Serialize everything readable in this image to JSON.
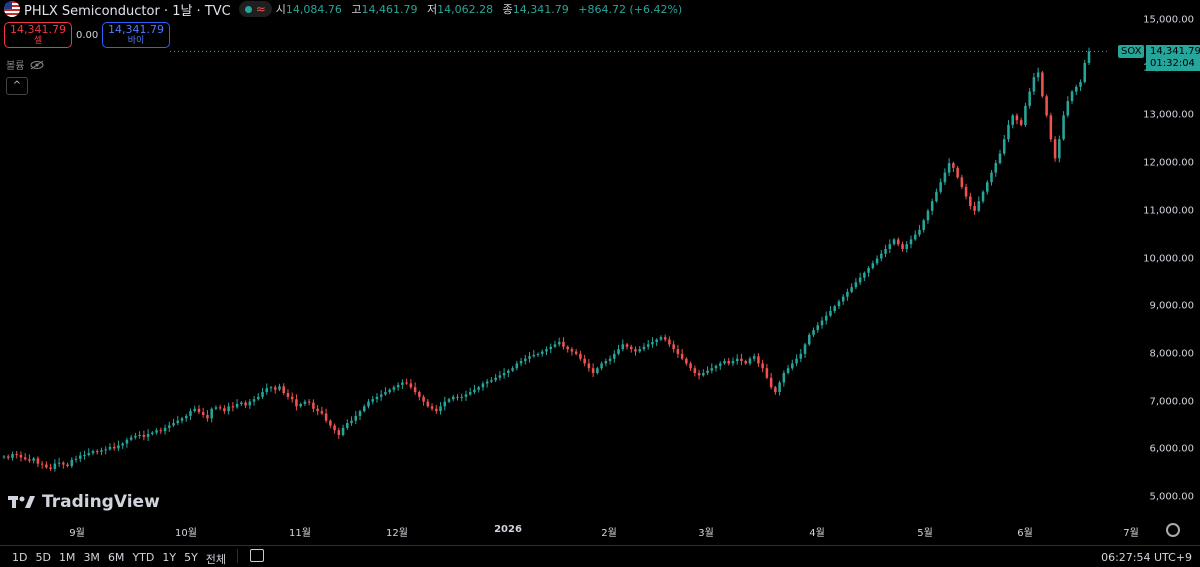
{
  "header": {
    "title": "PHLX Semiconductor · 1날 · TVC",
    "market_status_symbol": "≈",
    "ohlc": {
      "open_label": "시",
      "open": "14,084.76",
      "high_label": "고",
      "high": "14,461.79",
      "low_label": "저",
      "low": "14,062.28",
      "close_label": "종",
      "close": "14,341.79",
      "change": "+864.72 (+6.42%)"
    }
  },
  "trade": {
    "sell_price": "14,341.79",
    "sell_label": "셀",
    "spread": "0.00",
    "buy_price": "14,341.79",
    "buy_label": "바이"
  },
  "volume_label": "볼륨",
  "collapse_symbol": "^",
  "price_scale": {
    "ticks": [
      "15,000.00",
      "14,000.00",
      "13,000.00",
      "12,000.00",
      "11,000.00",
      "10,000.00",
      "9,000.00",
      "8,000.00",
      "7,000.00",
      "6,000.00",
      "5,000.00"
    ],
    "symbol_badge": "SOX",
    "last_price": "14,341.79",
    "countdown": "01:32:04"
  },
  "time_axis": {
    "ticks": [
      "9월",
      "10월",
      "11월",
      "12월",
      "2026",
      "2월",
      "3월",
      "4월",
      "5월",
      "6월",
      "7월"
    ]
  },
  "logo_text": "TradingView",
  "ranges": [
    "1D",
    "5D",
    "1M",
    "3M",
    "6M",
    "YTD",
    "1Y",
    "5Y",
    "전체"
  ],
  "clock": "06:27:54 UTC+9",
  "colors": {
    "up": "#26a69a",
    "down": "#ef5350",
    "background": "#000000"
  },
  "chart_data": {
    "type": "candlestick",
    "symbol": "SOX",
    "interval": "1D",
    "ylim": [
      5000,
      15000
    ],
    "close_series": [
      5850,
      5820,
      5900,
      5880,
      5830,
      5790,
      5760,
      5810,
      5700,
      5680,
      5620,
      5590,
      5700,
      5720,
      5680,
      5650,
      5780,
      5800,
      5870,
      5880,
      5920,
      5960,
      5950,
      5980,
      6000,
      6050,
      6020,
      6080,
      6120,
      6200,
      6250,
      6280,
      6300,
      6260,
      6320,
      6350,
      6400,
      6380,
      6450,
      6500,
      6550,
      6600,
      6650,
      6700,
      6800,
      6850,
      6780,
      6720,
      6650,
      6850,
      6880,
      6860,
      6800,
      6900,
      6880,
      6950,
      6980,
      6920,
      7000,
      7050,
      7100,
      7200,
      7280,
      7300,
      7250,
      7320,
      7180,
      7100,
      7050,
      6900,
      6950,
      7000,
      6980,
      6850,
      6800,
      6750,
      6600,
      6500,
      6400,
      6300,
      6450,
      6550,
      6600,
      6700,
      6800,
      6900,
      7000,
      7050,
      7100,
      7150,
      7200,
      7250,
      7300,
      7350,
      7400,
      7380,
      7300,
      7200,
      7100,
      7000,
      6900,
      6850,
      6800,
      6900,
      7000,
      7050,
      7100,
      7080,
      7100,
      7150,
      7200,
      7250,
      7300,
      7380,
      7420,
      7450,
      7500,
      7550,
      7600,
      7650,
      7700,
      7800,
      7850,
      7900,
      7950,
      7980,
      8000,
      8050,
      8100,
      8150,
      8200,
      8250,
      8150,
      8100,
      8050,
      8000,
      7900,
      7800,
      7700,
      7600,
      7700,
      7800,
      7850,
      7900,
      8000,
      8100,
      8200,
      8150,
      8100,
      8050,
      8100,
      8150,
      8200,
      8250,
      8300,
      8350,
      8300,
      8200,
      8100,
      8000,
      7900,
      7800,
      7700,
      7600,
      7550,
      7600,
      7650,
      7700,
      7750,
      7800,
      7850,
      7800,
      7850,
      7900,
      7850,
      7800,
      7900,
      7950,
      7800,
      7700,
      7500,
      7300,
      7200,
      7400,
      7600,
      7700,
      7800,
      7900,
      8000,
      8200,
      8400,
      8500,
      8600,
      8700,
      8800,
      8900,
      9000,
      9100,
      9200,
      9300,
      9400,
      9500,
      9600,
      9700,
      9800,
      9900,
      10000,
      10100,
      10200,
      10300,
      10400,
      10300,
      10200,
      10300,
      10400,
      10500,
      10600,
      10800,
      11000,
      11200,
      11400,
      11600,
      11800,
      12000,
      11900,
      11700,
      11500,
      11300,
      11100,
      11000,
      11200,
      11400,
      11600,
      11800,
      12000,
      12200,
      12500,
      12800,
      13000,
      12900,
      12800,
      13200,
      13500,
      13800,
      13900,
      13400,
      13000,
      12500,
      12100,
      12500,
      13000,
      13300,
      13500,
      13600,
      13700,
      14100,
      14342
    ],
    "x_tick_labels": [
      "9월",
      "10월",
      "11월",
      "12월",
      "2026",
      "2월",
      "3월",
      "4월",
      "5월",
      "6월",
      "7월"
    ],
    "last_close": 14341.79,
    "last_change": "+864.72 (+6.42%)"
  }
}
